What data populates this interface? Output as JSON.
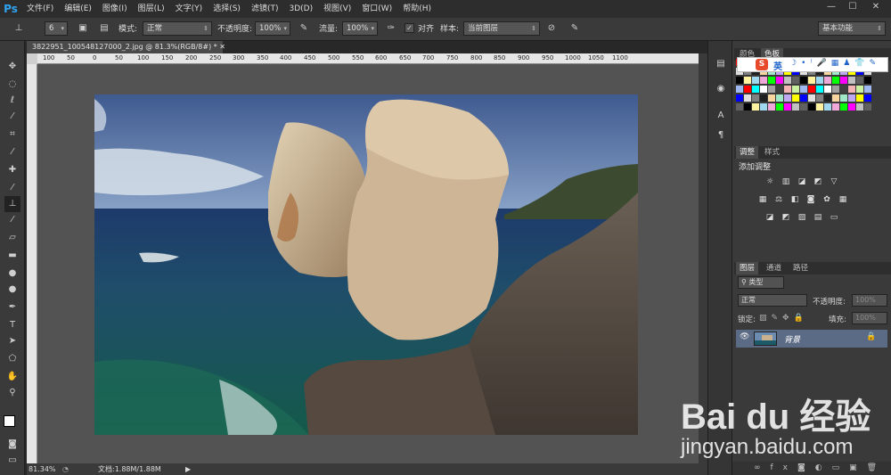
{
  "app": {
    "logo": "Ps"
  },
  "menu": [
    "文件(F)",
    "编辑(E)",
    "图像(I)",
    "图层(L)",
    "文字(Y)",
    "选择(S)",
    "滤镜(T)",
    "3D(D)",
    "视图(V)",
    "窗口(W)",
    "帮助(H)"
  ],
  "window_controls": [
    "—",
    "☐",
    "✕"
  ],
  "options": {
    "brush_size": "6",
    "mode_label": "模式:",
    "mode_value": "正常",
    "opacity_label": "不透明度:",
    "opacity_value": "100%",
    "flow_label": "流量:",
    "flow_value": "100%",
    "align_label": "对齐",
    "sample_label": "样本:",
    "sample_value": "当前图层",
    "workspace": "基本功能"
  },
  "document": {
    "tab_title": "3822951_100548127000_2.jpg @ 81.3%(RGB/8#) * ✕",
    "ruler_labels": [
      "100",
      "50",
      "0",
      "50",
      "100",
      "150",
      "200",
      "250",
      "300",
      "350",
      "400",
      "450",
      "500",
      "550",
      "600",
      "650",
      "700",
      "750",
      "800",
      "850",
      "900",
      "950",
      "1000",
      "1050",
      "1100"
    ],
    "status_zoom": "81.34%",
    "status_doc": "文档:1.88M/1.88M"
  },
  "panels": {
    "color_tab": "颜色",
    "swatch_tab": "色板",
    "adjust_tab": "调整",
    "style_tab": "样式",
    "adjust_title": "添加调整",
    "layers_tab": "图层",
    "channels_tab": "通道",
    "paths_tab": "路径",
    "kind_filter": "类型",
    "blend_mode": "正常",
    "opacity_label": "不透明度:",
    "opacity_value": "100%",
    "lock_label": "锁定:",
    "fill_label": "填充:",
    "fill_value": "100%",
    "layer_name": "背景"
  },
  "ime": {
    "logo": "S",
    "lang": "英"
  },
  "watermark": {
    "brand": "Bai du 经验",
    "url": "jingyan.baidu.com"
  },
  "colors": {
    "accent": "#2fa3f2",
    "selected_layer": "#5b6b85"
  }
}
